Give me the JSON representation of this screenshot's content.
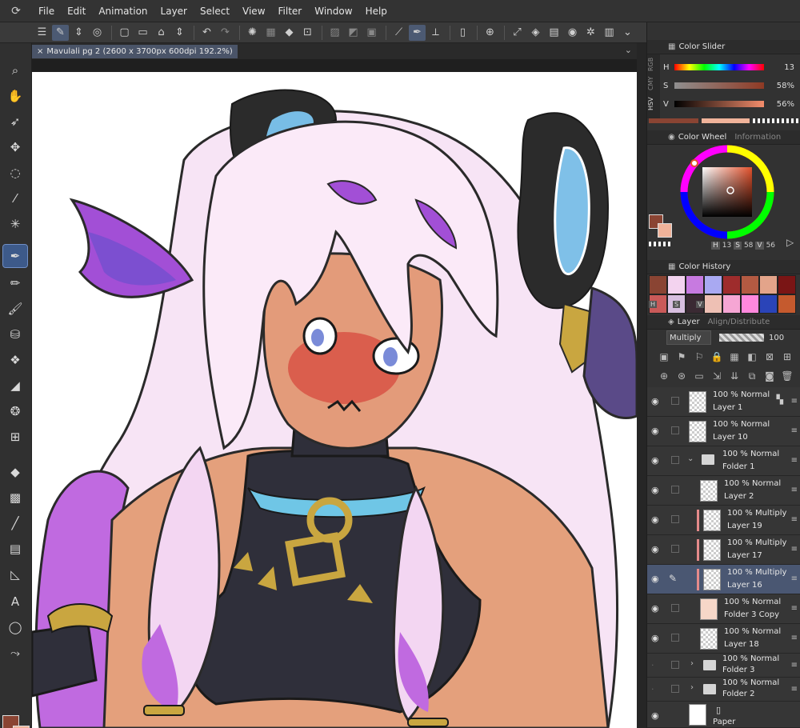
{
  "menubar": {
    "items": [
      "File",
      "Edit",
      "Animation",
      "Layer",
      "Select",
      "View",
      "Filter",
      "Window",
      "Help"
    ]
  },
  "document": {
    "tab_label": "Mavulali pg 2 (2600 x 3700px 600dpi 192.2%)"
  },
  "panels": {
    "color_slider": {
      "title": "Color Slider",
      "modes": [
        "RGB",
        "CMY",
        "HSV"
      ],
      "rows": [
        {
          "label": "H",
          "value": "13"
        },
        {
          "label": "S",
          "value": "58%"
        },
        {
          "label": "V",
          "value": "56%"
        }
      ]
    },
    "color_wheel": {
      "title": "Color Wheel",
      "info_tab": "Information",
      "readout": {
        "h_key": "H",
        "h": "13",
        "s_key": "S",
        "s": "58",
        "v_key": "V",
        "v": "56"
      }
    },
    "color_history": {
      "title": "Color History",
      "swatches": [
        "#8a4433",
        "#f3d3ef",
        "#c77ae0",
        "#a9a9f2",
        "#9e2c2c",
        "#b35a42",
        "#e3a48a",
        "#7a1515",
        "#c95a59",
        "#d8bfe0",
        "#3a2a33",
        "#eec0b4",
        "#f6a6d4",
        "#ff88dd",
        "#2a44b8",
        "#c55a2e"
      ],
      "keys": [
        "H",
        "S",
        "V"
      ]
    },
    "layer": {
      "title": "Layer",
      "align_tab": "Align/Distribute",
      "blend_mode": "Multiply",
      "opacity": "100"
    }
  },
  "layers": [
    {
      "opacity_mode": "100 % Normal",
      "name": "Layer 1",
      "indent": 0,
      "kind": "raster"
    },
    {
      "opacity_mode": "100 % Normal",
      "name": "Layer 10",
      "indent": 0,
      "kind": "raster"
    },
    {
      "opacity_mode": "100 % Normal",
      "name": "Folder 1",
      "indent": 0,
      "kind": "folder-open"
    },
    {
      "opacity_mode": "100 % Normal",
      "name": "Layer 2",
      "indent": 1,
      "kind": "raster"
    },
    {
      "opacity_mode": "100 % Multiply",
      "name": "Layer 19",
      "indent": 1,
      "kind": "clip"
    },
    {
      "opacity_mode": "100 % Multiply",
      "name": "Layer 17",
      "indent": 1,
      "kind": "clip"
    },
    {
      "opacity_mode": "100 % Multiply",
      "name": "Layer 16",
      "indent": 1,
      "kind": "clip",
      "selected": true
    },
    {
      "opacity_mode": "100 % Normal",
      "name": "Folder 3 Copy",
      "indent": 1,
      "kind": "art"
    },
    {
      "opacity_mode": "100 % Normal",
      "name": "Layer 18",
      "indent": 1,
      "kind": "raster"
    },
    {
      "opacity_mode": "100 % Normal",
      "name": "Folder 3",
      "indent": 0,
      "kind": "folder-closed"
    },
    {
      "opacity_mode": "100 % Normal",
      "name": "Folder 2",
      "indent": 0,
      "kind": "folder-closed"
    },
    {
      "opacity_mode": "",
      "name": "Paper",
      "indent": 0,
      "kind": "paper"
    }
  ],
  "colors": {
    "main": "#8a4433",
    "sub": "#f0b39a",
    "accent_selected": "#4a5772"
  }
}
